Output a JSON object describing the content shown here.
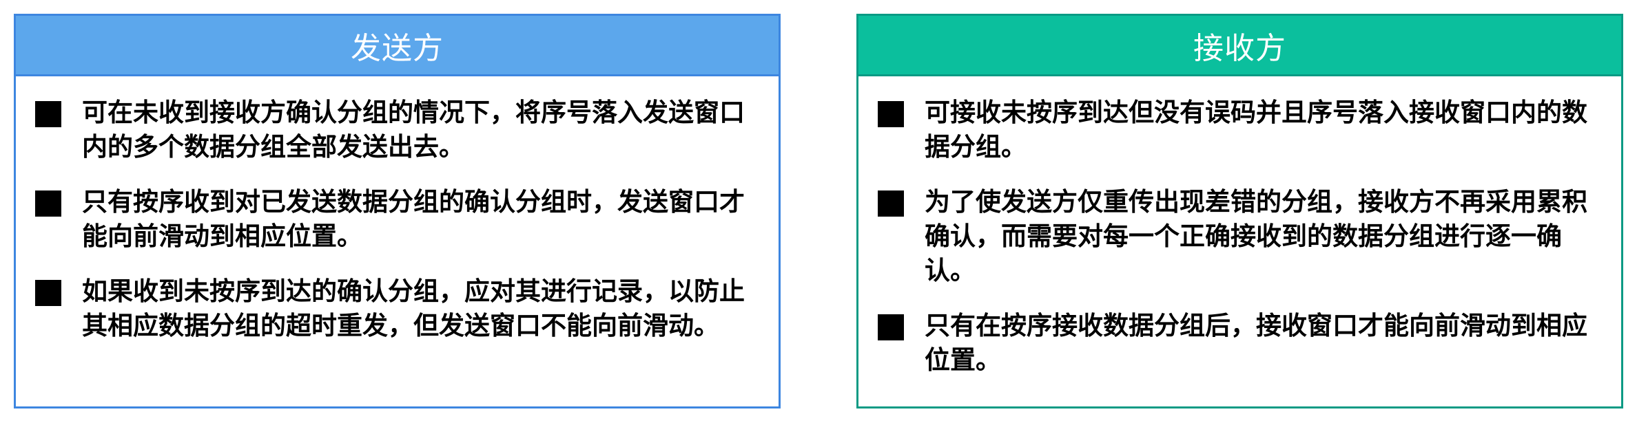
{
  "sender": {
    "title": "发送方",
    "color": "#5ca7ec",
    "items": [
      {
        "text": "可在未收到接收方确认分组的情况下，将序号落入发送窗口内的多个数据分组全部发送出去。"
      },
      {
        "text": "只有按序收到对已发送数据分组的确认分组时，发送窗口才能向前滑动到相应位置。"
      },
      {
        "text": "如果收到未按序到达的确认分组，应对其进行记录，以防止其相应数据分组的超时重发，但发送窗口不能向前滑动。"
      }
    ]
  },
  "receiver": {
    "title": "接收方",
    "color": "#0bbf9d",
    "items": [
      {
        "text": "可接收未按序到达但没有误码并且序号落入接收窗口内的数据分组。"
      },
      {
        "text": "为了使发送方仅重传出现差错的分组，接收方不再采用累积确认，而需要对每一个正确接收到的数据分组进行逐一确认。"
      },
      {
        "text": "只有在按序接收数据分组后，接收窗口才能向前滑动到相应位置。"
      }
    ]
  }
}
